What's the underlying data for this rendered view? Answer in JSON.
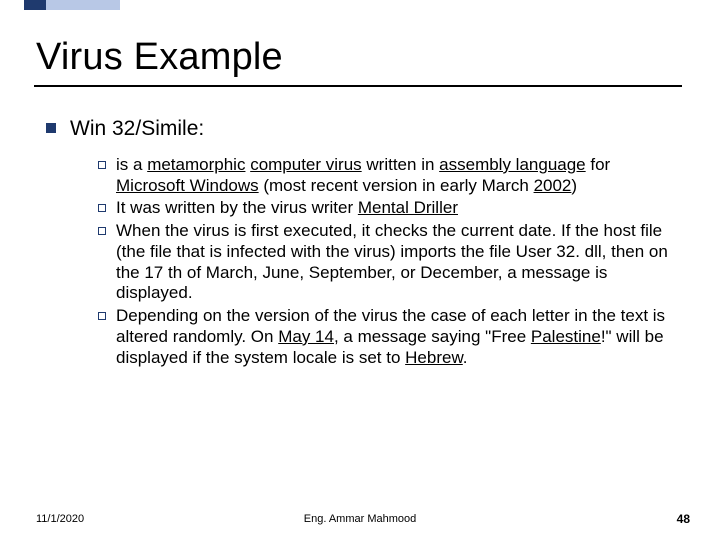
{
  "title": "Virus Example",
  "subtitle": "Win 32/Simile:",
  "bullets": {
    "b0": {
      "pre": "is a ",
      "u1": "metamorphic",
      "mid1": " ",
      "u2": "computer virus",
      "mid2": " written in ",
      "u3": "assembly language",
      "mid3": " for ",
      "u4": "Microsoft Windows",
      "mid4": " (most recent version in early March ",
      "u5": "2002",
      "post": ")"
    },
    "b1": {
      "pre": "It was written by the virus writer ",
      "u1": "Mental Driller"
    },
    "b2": {
      "text": "When the virus is first executed, it checks the current date. If the host file (the file that is infected with the virus) imports the file User 32. dll, then on the 17 th of March, June, September, or December, a message is displayed."
    },
    "b3": {
      "pre": "Depending on the version of the virus the case of each letter in the text is altered randomly. On ",
      "u1": "May 14",
      "mid1": ", a message saying \"Free ",
      "u2": "Palestine",
      "mid2": "!\" will be displayed if the system locale is set to ",
      "u3": "Hebrew",
      "post": "."
    }
  },
  "footer": {
    "date": "11/1/2020",
    "center": "Eng. Ammar Mahmood",
    "page": "48"
  }
}
